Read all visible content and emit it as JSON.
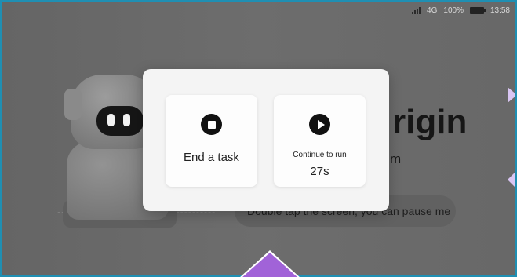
{
  "status_bar": {
    "network": "4G",
    "battery_percent": "100%",
    "time": "13:58",
    "signal_icon": "signal-bars-icon",
    "battery_icon": "battery-icon"
  },
  "background": {
    "title_fragment": "rigin",
    "subtitle_fragment": "m",
    "hint": "Double tap the screen, you can pause me"
  },
  "dialog": {
    "end_task": {
      "icon": "stop-icon",
      "label": "End a task"
    },
    "continue": {
      "icon": "play-icon",
      "label": "Continue to run",
      "countdown": "27s"
    }
  },
  "colors": {
    "frame": "#1f8fb3",
    "accent_purple": "#a163d8",
    "dialog_bg": "#f4f4f4"
  }
}
